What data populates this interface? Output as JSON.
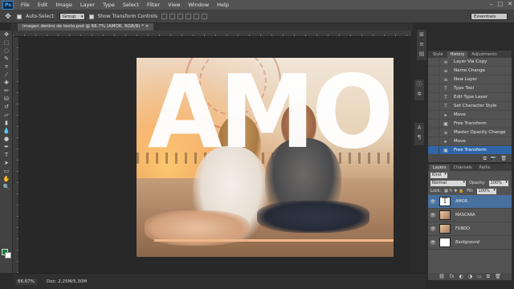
{
  "menubar": {
    "logo": "Ps",
    "items": [
      "File",
      "Edit",
      "Image",
      "Layer",
      "Type",
      "Select",
      "Filter",
      "View",
      "Window",
      "Help"
    ],
    "window_controls": [
      "–",
      "□",
      "✕"
    ]
  },
  "options_bar": {
    "auto_select_label": "Auto-Select:",
    "auto_select_target": "Group",
    "show_transform_label": "Show Transform Controls",
    "workspace": "Essentials"
  },
  "document_tab": {
    "title": "Imagen dentro de texto.psd @ 66.7% (AMOR, RGB/8) *",
    "close": "×"
  },
  "canvas": {
    "text": "AMOR"
  },
  "history_panel": {
    "tabs": [
      "Style",
      "History",
      "Adjustments"
    ],
    "active_tab": "History",
    "items": [
      {
        "icon": "≡",
        "label": "Layer Via Copy"
      },
      {
        "icon": "≡",
        "label": "Name Change"
      },
      {
        "icon": "≡",
        "label": "New Layer"
      },
      {
        "icon": "T",
        "label": "Type Tool"
      },
      {
        "icon": "T",
        "label": "Edit Type Layer"
      },
      {
        "icon": "T",
        "label": "Set Character Style"
      },
      {
        "icon": "▸",
        "label": "Move"
      },
      {
        "icon": "▣",
        "label": "Free Transform"
      },
      {
        "icon": "≡",
        "label": "Master Opacity Change"
      },
      {
        "icon": "▸",
        "label": "Move"
      },
      {
        "icon": "▣",
        "label": "Free Transform"
      }
    ],
    "selected_index": 10,
    "footer_icons": [
      "⧉",
      "📷",
      "🗑"
    ]
  },
  "layers_panel": {
    "tabs": [
      "Layers",
      "Channels",
      "Paths"
    ],
    "active_tab": "Layers",
    "kind_filter": "Kind",
    "blend_mode": "Normal",
    "opacity_label": "Opacity:",
    "opacity_value": "100%",
    "lock_label": "Lock:",
    "fill_label": "Fill:",
    "fill_value": "100%",
    "layers": [
      {
        "name": "AMOR",
        "thumb": "type",
        "selected": true
      },
      {
        "name": "MASCARA",
        "thumb": "photo",
        "selected": false
      },
      {
        "name": "FUNDO",
        "thumb": "photo",
        "selected": false
      },
      {
        "name": "Background",
        "thumb": "white",
        "selected": false
      }
    ],
    "footer_icons": [
      "⛓",
      "fx",
      "◐",
      "◑",
      "▭",
      "⧉",
      "🗑"
    ]
  },
  "status_bar": {
    "zoom": "66.67%",
    "doc": "Doc: 2,25M/5,30M"
  },
  "colors": {
    "foreground": "#1a7a3a",
    "background": "#ffffff",
    "selection": "#2f66a8"
  }
}
